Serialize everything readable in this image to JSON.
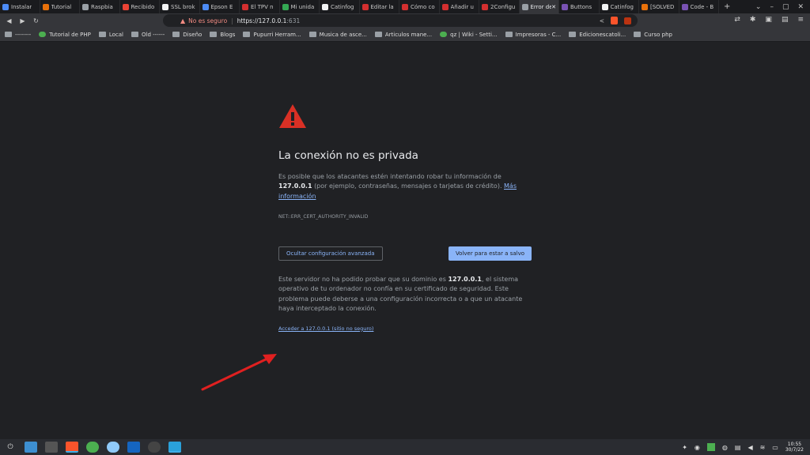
{
  "tabs": [
    {
      "label": "Instalar",
      "color": "#4c8bf5"
    },
    {
      "label": "Tutorial",
      "color": "#e8710a"
    },
    {
      "label": "Raspbia",
      "color": "#9aa0a6"
    },
    {
      "label": "Recibido",
      "color": "#ea4335"
    },
    {
      "label": "SSL brok",
      "color": "#f1f3f4"
    },
    {
      "label": "Epson E",
      "color": "#4c8bf5"
    },
    {
      "label": "El TPV n",
      "color": "#d32f2f"
    },
    {
      "label": "Mi unida",
      "color": "#34a853"
    },
    {
      "label": "Catinfog",
      "color": "#f1f3f4"
    },
    {
      "label": "Editar la",
      "color": "#d32f2f"
    },
    {
      "label": "Cómo co",
      "color": "#d32f2f"
    },
    {
      "label": "Añadir u",
      "color": "#d32f2f"
    },
    {
      "label": "2Configu",
      "color": "#d32f2f"
    },
    {
      "label": "Error de p",
      "color": "#9aa0a6",
      "active": true
    },
    {
      "label": "Buttons",
      "color": "#7952b3"
    },
    {
      "label": "Catinfog",
      "color": "#f1f3f4"
    },
    {
      "label": "[SOLVED",
      "color": "#e8710a"
    },
    {
      "label": "Code - B",
      "color": "#7952b3"
    }
  ],
  "new_tab_label": "+",
  "window_controls": [
    "⌄",
    "–",
    "▢",
    "✕"
  ],
  "address": {
    "security_label": "No es seguro",
    "url_scheme_host": "https://127.0.0.1",
    "url_port": ":631"
  },
  "bookmarks": [
    {
      "label": "--------",
      "type": "folder"
    },
    {
      "label": "Tutorial de PHP",
      "type": "site"
    },
    {
      "label": "Local",
      "type": "folder"
    },
    {
      "label": "Old ------",
      "type": "folder"
    },
    {
      "label": "Diseño",
      "type": "folder"
    },
    {
      "label": "Blogs",
      "type": "folder"
    },
    {
      "label": "Pupurri Herram...",
      "type": "folder"
    },
    {
      "label": "Musica de asce...",
      "type": "folder"
    },
    {
      "label": "Articulos mane...",
      "type": "folder"
    },
    {
      "label": "qz | Wiki - Setti...",
      "type": "site"
    },
    {
      "label": "Impresoras - C...",
      "type": "folder"
    },
    {
      "label": "Edicionescatoli...",
      "type": "folder"
    },
    {
      "label": "Curso php",
      "type": "folder"
    }
  ],
  "interstitial": {
    "heading": "La conexión no es privada",
    "explanation_pre": "Es posible que los atacantes estén intentando robar tu información de",
    "explanation_host": "127.0.0.1",
    "explanation_post": "(por ejemplo, contraseñas, mensajes o tarjetas de crédito).",
    "more_info_link": "Más información",
    "error_code": "NET::ERR_CERT_AUTHORITY_INVALID",
    "advanced_button": "Ocultar configuración avanzada",
    "back_button": "Volver para estar a salvo",
    "details_pre": "Este servidor no ha podido probar que su dominio es",
    "details_host": "127.0.0.1",
    "details_post": ", el sistema operativo de tu ordenador no confía en su certificado de seguridad. Este problema puede deberse a una configuración incorrecta o a que un atacante haya interceptado la conexión.",
    "proceed_link": "Acceder a 127.0.0.1 (sitio no seguro)"
  },
  "colors": {
    "warning": "#d93025",
    "arrow": "#e02020",
    "link": "#8ab4f8",
    "primary_button": "#8ab4f8"
  },
  "taskbar": {
    "apps": [
      "kde-menu-icon",
      "dolphin-icon",
      "konsole-icon",
      "brave-icon",
      "vivaldi-icon",
      "chromium-icon",
      "joplin-icon",
      "steam-icon",
      "telegram-icon"
    ],
    "clock_time": "10:55",
    "clock_date": "30/7/22"
  }
}
